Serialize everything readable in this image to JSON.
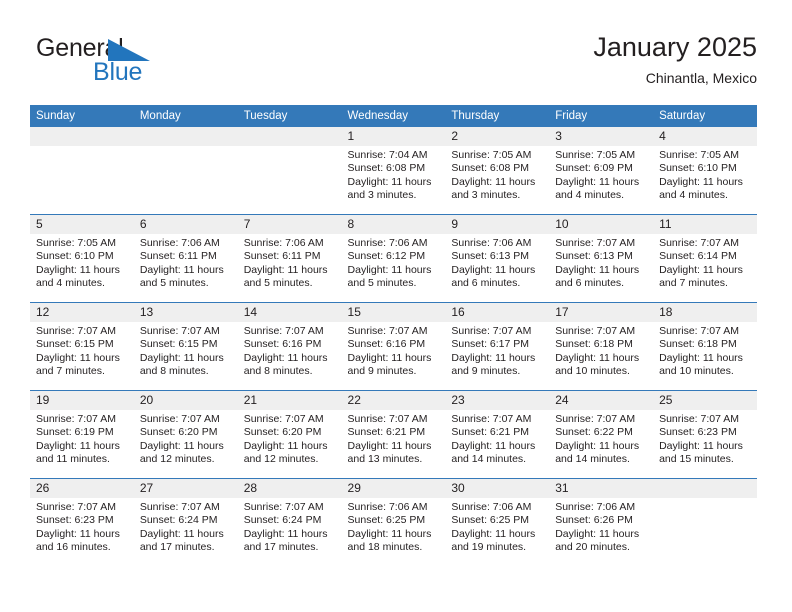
{
  "brand": {
    "name_part1": "General",
    "name_part2": "Blue",
    "accent_color": "#2275bd"
  },
  "header": {
    "title": "January 2025",
    "subtitle": "Chinantla, Mexico",
    "header_bg_color": "#3479b9",
    "daynum_bg_color": "#efefef"
  },
  "weekdays": [
    "Sunday",
    "Monday",
    "Tuesday",
    "Wednesday",
    "Thursday",
    "Friday",
    "Saturday"
  ],
  "labels": {
    "sunrise": "Sunrise:",
    "sunset": "Sunset:",
    "daylight": "Daylight:"
  },
  "weeks": [
    [
      {
        "day": "",
        "sunrise": "",
        "sunset": "",
        "daylight_line1": "",
        "daylight_line2": "",
        "empty": true
      },
      {
        "day": "",
        "sunrise": "",
        "sunset": "",
        "daylight_line1": "",
        "daylight_line2": "",
        "empty": true
      },
      {
        "day": "",
        "sunrise": "",
        "sunset": "",
        "daylight_line1": "",
        "daylight_line2": "",
        "empty": true
      },
      {
        "day": "1",
        "sunrise": "Sunrise: 7:04 AM",
        "sunset": "Sunset: 6:08 PM",
        "daylight_line1": "Daylight: 11 hours",
        "daylight_line2": "and 3 minutes."
      },
      {
        "day": "2",
        "sunrise": "Sunrise: 7:05 AM",
        "sunset": "Sunset: 6:08 PM",
        "daylight_line1": "Daylight: 11 hours",
        "daylight_line2": "and 3 minutes."
      },
      {
        "day": "3",
        "sunrise": "Sunrise: 7:05 AM",
        "sunset": "Sunset: 6:09 PM",
        "daylight_line1": "Daylight: 11 hours",
        "daylight_line2": "and 4 minutes."
      },
      {
        "day": "4",
        "sunrise": "Sunrise: 7:05 AM",
        "sunset": "Sunset: 6:10 PM",
        "daylight_line1": "Daylight: 11 hours",
        "daylight_line2": "and 4 minutes."
      }
    ],
    [
      {
        "day": "5",
        "sunrise": "Sunrise: 7:05 AM",
        "sunset": "Sunset: 6:10 PM",
        "daylight_line1": "Daylight: 11 hours",
        "daylight_line2": "and 4 minutes."
      },
      {
        "day": "6",
        "sunrise": "Sunrise: 7:06 AM",
        "sunset": "Sunset: 6:11 PM",
        "daylight_line1": "Daylight: 11 hours",
        "daylight_line2": "and 5 minutes."
      },
      {
        "day": "7",
        "sunrise": "Sunrise: 7:06 AM",
        "sunset": "Sunset: 6:11 PM",
        "daylight_line1": "Daylight: 11 hours",
        "daylight_line2": "and 5 minutes."
      },
      {
        "day": "8",
        "sunrise": "Sunrise: 7:06 AM",
        "sunset": "Sunset: 6:12 PM",
        "daylight_line1": "Daylight: 11 hours",
        "daylight_line2": "and 5 minutes."
      },
      {
        "day": "9",
        "sunrise": "Sunrise: 7:06 AM",
        "sunset": "Sunset: 6:13 PM",
        "daylight_line1": "Daylight: 11 hours",
        "daylight_line2": "and 6 minutes."
      },
      {
        "day": "10",
        "sunrise": "Sunrise: 7:07 AM",
        "sunset": "Sunset: 6:13 PM",
        "daylight_line1": "Daylight: 11 hours",
        "daylight_line2": "and 6 minutes."
      },
      {
        "day": "11",
        "sunrise": "Sunrise: 7:07 AM",
        "sunset": "Sunset: 6:14 PM",
        "daylight_line1": "Daylight: 11 hours",
        "daylight_line2": "and 7 minutes."
      }
    ],
    [
      {
        "day": "12",
        "sunrise": "Sunrise: 7:07 AM",
        "sunset": "Sunset: 6:15 PM",
        "daylight_line1": "Daylight: 11 hours",
        "daylight_line2": "and 7 minutes."
      },
      {
        "day": "13",
        "sunrise": "Sunrise: 7:07 AM",
        "sunset": "Sunset: 6:15 PM",
        "daylight_line1": "Daylight: 11 hours",
        "daylight_line2": "and 8 minutes."
      },
      {
        "day": "14",
        "sunrise": "Sunrise: 7:07 AM",
        "sunset": "Sunset: 6:16 PM",
        "daylight_line1": "Daylight: 11 hours",
        "daylight_line2": "and 8 minutes."
      },
      {
        "day": "15",
        "sunrise": "Sunrise: 7:07 AM",
        "sunset": "Sunset: 6:16 PM",
        "daylight_line1": "Daylight: 11 hours",
        "daylight_line2": "and 9 minutes."
      },
      {
        "day": "16",
        "sunrise": "Sunrise: 7:07 AM",
        "sunset": "Sunset: 6:17 PM",
        "daylight_line1": "Daylight: 11 hours",
        "daylight_line2": "and 9 minutes."
      },
      {
        "day": "17",
        "sunrise": "Sunrise: 7:07 AM",
        "sunset": "Sunset: 6:18 PM",
        "daylight_line1": "Daylight: 11 hours",
        "daylight_line2": "and 10 minutes."
      },
      {
        "day": "18",
        "sunrise": "Sunrise: 7:07 AM",
        "sunset": "Sunset: 6:18 PM",
        "daylight_line1": "Daylight: 11 hours",
        "daylight_line2": "and 10 minutes."
      }
    ],
    [
      {
        "day": "19",
        "sunrise": "Sunrise: 7:07 AM",
        "sunset": "Sunset: 6:19 PM",
        "daylight_line1": "Daylight: 11 hours",
        "daylight_line2": "and 11 minutes."
      },
      {
        "day": "20",
        "sunrise": "Sunrise: 7:07 AM",
        "sunset": "Sunset: 6:20 PM",
        "daylight_line1": "Daylight: 11 hours",
        "daylight_line2": "and 12 minutes."
      },
      {
        "day": "21",
        "sunrise": "Sunrise: 7:07 AM",
        "sunset": "Sunset: 6:20 PM",
        "daylight_line1": "Daylight: 11 hours",
        "daylight_line2": "and 12 minutes."
      },
      {
        "day": "22",
        "sunrise": "Sunrise: 7:07 AM",
        "sunset": "Sunset: 6:21 PM",
        "daylight_line1": "Daylight: 11 hours",
        "daylight_line2": "and 13 minutes."
      },
      {
        "day": "23",
        "sunrise": "Sunrise: 7:07 AM",
        "sunset": "Sunset: 6:21 PM",
        "daylight_line1": "Daylight: 11 hours",
        "daylight_line2": "and 14 minutes."
      },
      {
        "day": "24",
        "sunrise": "Sunrise: 7:07 AM",
        "sunset": "Sunset: 6:22 PM",
        "daylight_line1": "Daylight: 11 hours",
        "daylight_line2": "and 14 minutes."
      },
      {
        "day": "25",
        "sunrise": "Sunrise: 7:07 AM",
        "sunset": "Sunset: 6:23 PM",
        "daylight_line1": "Daylight: 11 hours",
        "daylight_line2": "and 15 minutes."
      }
    ],
    [
      {
        "day": "26",
        "sunrise": "Sunrise: 7:07 AM",
        "sunset": "Sunset: 6:23 PM",
        "daylight_line1": "Daylight: 11 hours",
        "daylight_line2": "and 16 minutes."
      },
      {
        "day": "27",
        "sunrise": "Sunrise: 7:07 AM",
        "sunset": "Sunset: 6:24 PM",
        "daylight_line1": "Daylight: 11 hours",
        "daylight_line2": "and 17 minutes."
      },
      {
        "day": "28",
        "sunrise": "Sunrise: 7:07 AM",
        "sunset": "Sunset: 6:24 PM",
        "daylight_line1": "Daylight: 11 hours",
        "daylight_line2": "and 17 minutes."
      },
      {
        "day": "29",
        "sunrise": "Sunrise: 7:06 AM",
        "sunset": "Sunset: 6:25 PM",
        "daylight_line1": "Daylight: 11 hours",
        "daylight_line2": "and 18 minutes."
      },
      {
        "day": "30",
        "sunrise": "Sunrise: 7:06 AM",
        "sunset": "Sunset: 6:25 PM",
        "daylight_line1": "Daylight: 11 hours",
        "daylight_line2": "and 19 minutes."
      },
      {
        "day": "31",
        "sunrise": "Sunrise: 7:06 AM",
        "sunset": "Sunset: 6:26 PM",
        "daylight_line1": "Daylight: 11 hours",
        "daylight_line2": "and 20 minutes."
      },
      {
        "day": "",
        "sunrise": "",
        "sunset": "",
        "daylight_line1": "",
        "daylight_line2": "",
        "empty": true
      }
    ]
  ]
}
